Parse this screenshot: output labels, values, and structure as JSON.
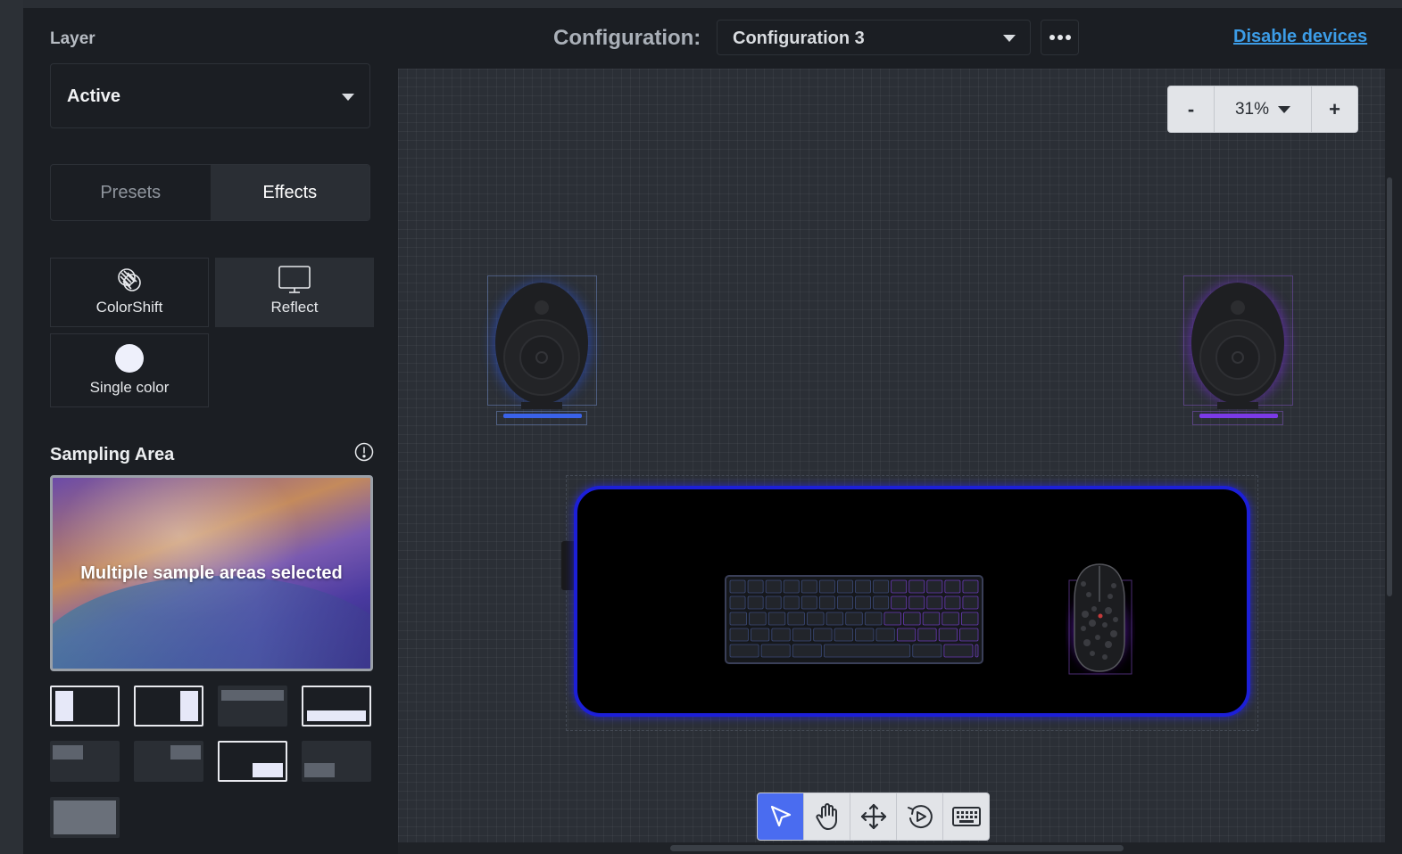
{
  "layer": {
    "label": "Layer",
    "selected": "Active"
  },
  "tabs": [
    {
      "label": "Presets"
    },
    {
      "label": "Effects"
    }
  ],
  "effects": [
    {
      "label": "ColorShift",
      "icon": "colorshift-icon"
    },
    {
      "label": "Reflect",
      "icon": "monitor-icon",
      "selected": true
    },
    {
      "label": "Single color",
      "icon": "circle-icon"
    }
  ],
  "sampling": {
    "label": "Sampling Area",
    "preview_text": "Multiple sample areas selected",
    "areas": [
      {
        "name": "left-half",
        "selected": true
      },
      {
        "name": "right-half",
        "selected": true
      },
      {
        "name": "top-half",
        "selected": false
      },
      {
        "name": "bottom-half",
        "selected": true
      },
      {
        "name": "top-left",
        "selected": false
      },
      {
        "name": "top-right",
        "selected": false
      },
      {
        "name": "bottom-right",
        "selected": true
      },
      {
        "name": "bottom-left",
        "selected": false
      },
      {
        "name": "full",
        "selected": false
      }
    ]
  },
  "header": {
    "config_label": "Configuration:",
    "config_value": "Configuration 3",
    "disable_link": "Disable devices"
  },
  "zoom": {
    "minus": "-",
    "level": "31%",
    "plus": "+"
  },
  "tools": [
    {
      "name": "select-tool",
      "active": true
    },
    {
      "name": "pan-tool",
      "active": false
    },
    {
      "name": "move-tool",
      "active": false
    },
    {
      "name": "rotate-tool",
      "active": false
    },
    {
      "name": "keyboard-tool",
      "active": false
    }
  ],
  "colors": {
    "accent": "#4a6cf0",
    "link": "#3c9ce6",
    "pad_glow": "#1c1fd8"
  }
}
